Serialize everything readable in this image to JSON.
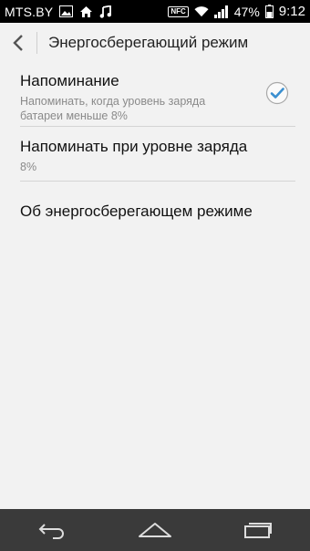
{
  "status_bar": {
    "carrier": "MTS.BY",
    "nfc": "NFC",
    "battery_percent": "47%",
    "time": "9:12",
    "icons": [
      "image-icon",
      "home-icon",
      "music-note-icon",
      "nfc-icon",
      "wifi-icon",
      "signal-icon",
      "battery-icon"
    ]
  },
  "header": {
    "title": "Энергосберегающий режим",
    "back_icon": "back-chevron-icon"
  },
  "settings": {
    "reminder": {
      "title": "Напоминание",
      "summary": "Напоминать, когда уровень заряда батареи меньше 8%",
      "checked": true
    },
    "remind_level": {
      "title": "Напоминать при уровне заряда",
      "summary": "8%"
    },
    "about": {
      "title": "Об энергосберегающем режиме"
    }
  },
  "nav_bar": {
    "icons": [
      "back-icon",
      "home-icon",
      "recents-icon"
    ]
  },
  "colors": {
    "accent": "#3a8fd0",
    "background": "#f2f2f2",
    "navbar": "#3a3a3a"
  }
}
